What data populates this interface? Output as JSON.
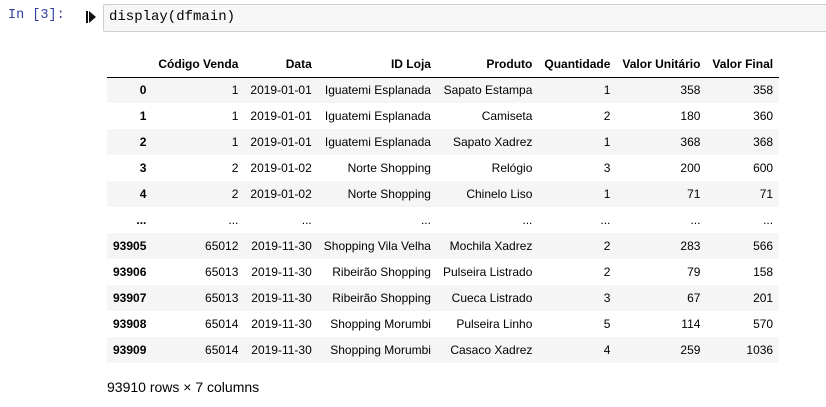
{
  "cell": {
    "prompt": "In [3]:",
    "code": "display(dfmain)"
  },
  "table": {
    "columns": [
      "",
      "Código Venda",
      "Data",
      "ID Loja",
      "Produto",
      "Quantidade",
      "Valor Unitário",
      "Valor Final"
    ],
    "rows": [
      [
        "0",
        "1",
        "2019-01-01",
        "Iguatemi Esplanada",
        "Sapato Estampa",
        "1",
        "358",
        "358"
      ],
      [
        "1",
        "1",
        "2019-01-01",
        "Iguatemi Esplanada",
        "Camiseta",
        "2",
        "180",
        "360"
      ],
      [
        "2",
        "1",
        "2019-01-01",
        "Iguatemi Esplanada",
        "Sapato Xadrez",
        "1",
        "368",
        "368"
      ],
      [
        "3",
        "2",
        "2019-01-02",
        "Norte Shopping",
        "Relógio",
        "3",
        "200",
        "600"
      ],
      [
        "4",
        "2",
        "2019-01-02",
        "Norte Shopping",
        "Chinelo Liso",
        "1",
        "71",
        "71"
      ],
      [
        "...",
        "...",
        "...",
        "...",
        "...",
        "...",
        "...",
        "..."
      ],
      [
        "93905",
        "65012",
        "2019-11-30",
        "Shopping Vila Velha",
        "Mochila Xadrez",
        "2",
        "283",
        "566"
      ],
      [
        "93906",
        "65013",
        "2019-11-30",
        "Ribeirão Shopping",
        "Pulseira Listrado",
        "2",
        "79",
        "158"
      ],
      [
        "93907",
        "65013",
        "2019-11-30",
        "Ribeirão Shopping",
        "Cueca Listrado",
        "3",
        "67",
        "201"
      ],
      [
        "93908",
        "65014",
        "2019-11-30",
        "Shopping Morumbi",
        "Pulseira Linho",
        "5",
        "114",
        "570"
      ],
      [
        "93909",
        "65014",
        "2019-11-30",
        "Shopping Morumbi",
        "Casaco Xadrez",
        "4",
        "259",
        "1036"
      ]
    ]
  },
  "footer": "93910 rows × 7 columns",
  "colors": {
    "prompt": "#303f9f",
    "input_bg": "#f7f7f7",
    "stripe": "#f5f5f5"
  },
  "icons": {
    "run": "run-arrow-icon"
  }
}
